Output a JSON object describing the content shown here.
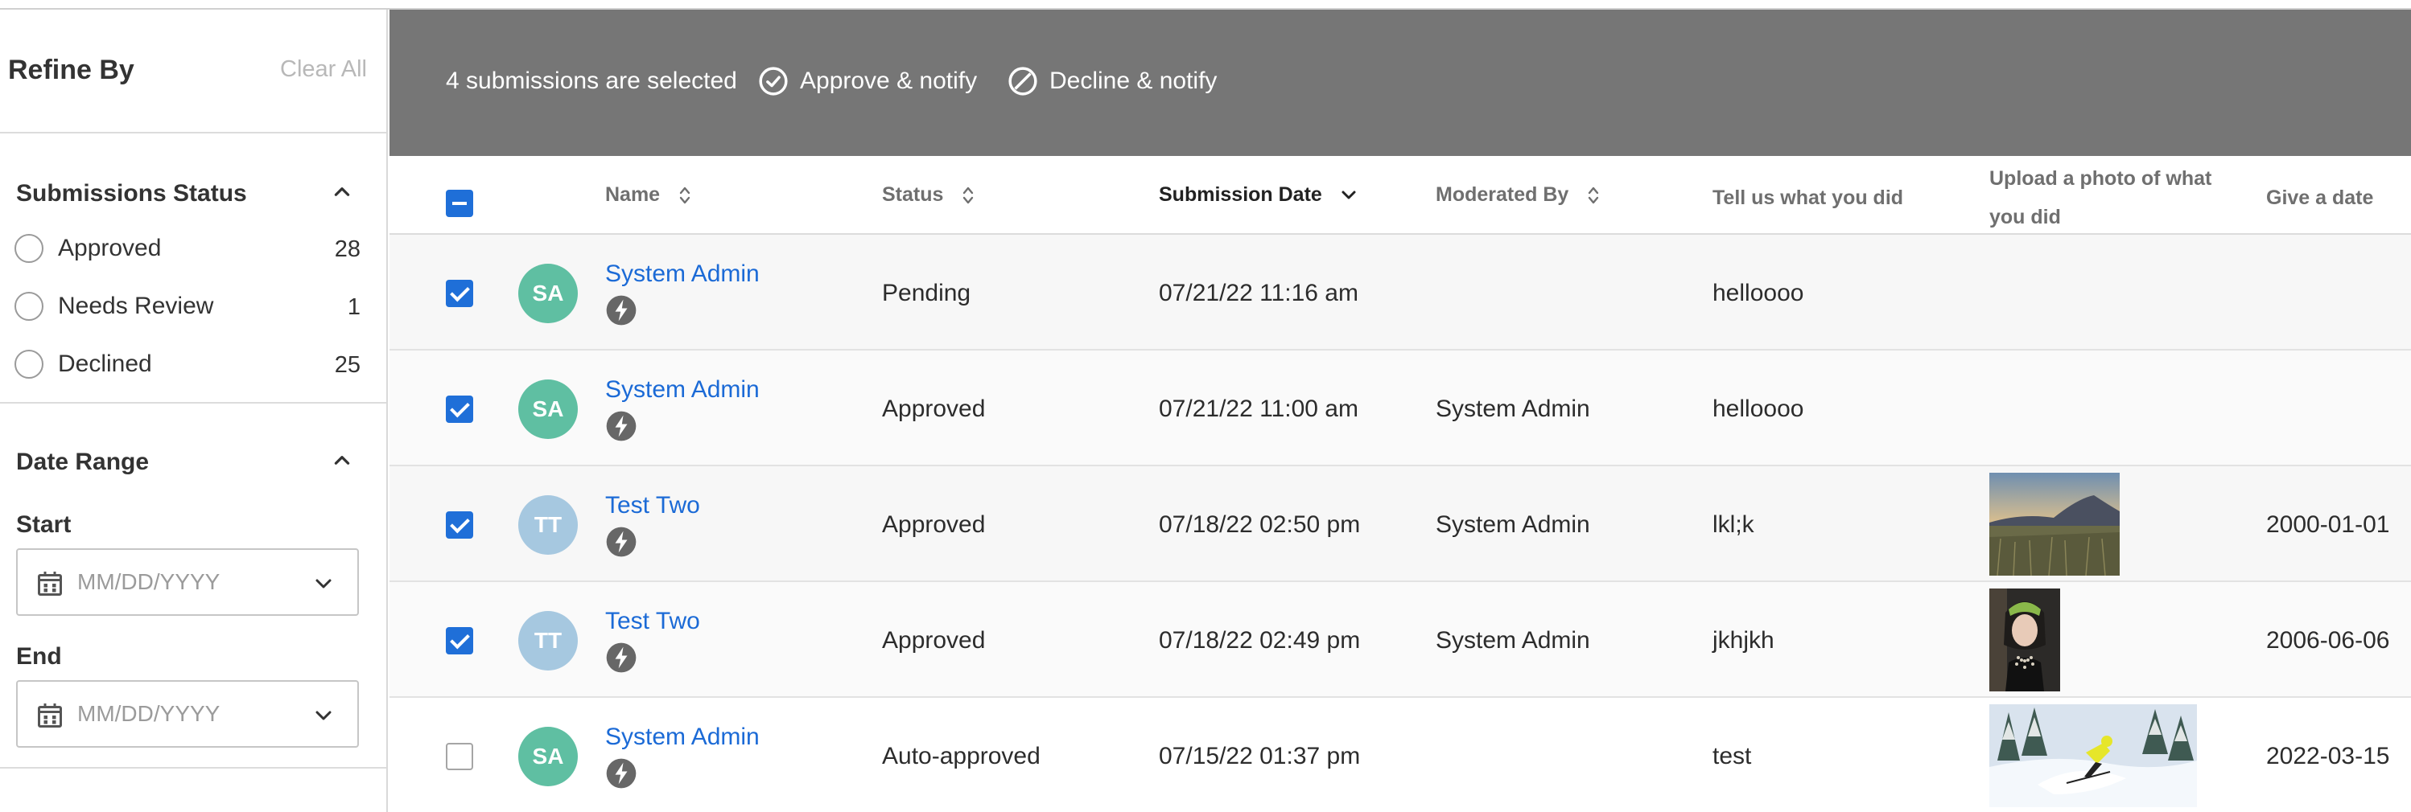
{
  "sidebar": {
    "title": "Refine By",
    "clear_all": "Clear All",
    "status_section": {
      "title": "Submissions Status",
      "options": [
        {
          "label": "Approved",
          "count": "28"
        },
        {
          "label": "Needs Review",
          "count": "1"
        },
        {
          "label": "Declined",
          "count": "25"
        }
      ]
    },
    "date_section": {
      "title": "Date Range",
      "start_label": "Start",
      "end_label": "End",
      "start_placeholder": "MM/DD/YYYY",
      "end_placeholder": "MM/DD/YYYY"
    }
  },
  "actionbar": {
    "selection_text": "4 submissions are selected",
    "approve_label": "Approve & notify",
    "decline_label": "Decline & notify"
  },
  "table": {
    "columns": {
      "name": "Name",
      "status": "Status",
      "submission_date": "Submission Date",
      "moderated_by": "Moderated By",
      "tell_us": "Tell us what you did",
      "upload_photo_line1": "Upload a photo of what",
      "upload_photo_line2": "you did",
      "give_date": "Give a date"
    },
    "rows": [
      {
        "checked": true,
        "initials": "SA",
        "avatar_color": "#5fbfa2",
        "name": "System Admin",
        "status": "Pending",
        "date": "07/21/22 11:16 am",
        "moderated_by": "",
        "tell_us": "helloooo",
        "photo": "",
        "give_date": ""
      },
      {
        "checked": true,
        "initials": "SA",
        "avatar_color": "#5fbfa2",
        "name": "System Admin",
        "status": "Approved",
        "date": "07/21/22 11:00 am",
        "moderated_by": "System Admin",
        "tell_us": "helloooo",
        "photo": "",
        "give_date": ""
      },
      {
        "checked": true,
        "initials": "TT",
        "avatar_color": "#a6c8e0",
        "name": "Test Two",
        "status": "Approved",
        "date": "07/18/22 02:50 pm",
        "moderated_by": "System Admin",
        "tell_us": "lkl;k",
        "photo": "landscape-field-photo",
        "give_date": "2000-01-01"
      },
      {
        "checked": true,
        "initials": "TT",
        "avatar_color": "#a6c8e0",
        "name": "Test Two",
        "status": "Approved",
        "date": "07/18/22 02:49 pm",
        "moderated_by": "System Admin",
        "tell_us": "jkhjkh",
        "photo": "portrait-person-photo",
        "give_date": "2006-06-06"
      },
      {
        "checked": false,
        "initials": "SA",
        "avatar_color": "#5fbfa2",
        "name": "System Admin",
        "status": "Auto-approved",
        "date": "07/15/22 01:37 pm",
        "moderated_by": "",
        "tell_us": "test",
        "photo": "skier-snow-photo",
        "give_date": "2022-03-15"
      }
    ]
  },
  "colors": {
    "accent": "#1f6fd8",
    "link": "#1b6ad6",
    "actionbar_bg": "#767676"
  }
}
